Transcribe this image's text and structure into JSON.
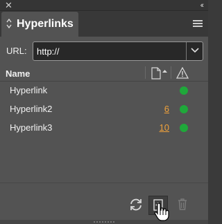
{
  "titlebar": {
    "close_icon": "close-icon",
    "collapse_icon": "collapse-icon"
  },
  "tab": {
    "label": "Hyperlinks"
  },
  "url": {
    "label": "URL:",
    "value": "http://"
  },
  "table": {
    "header_name": "Name",
    "rows": [
      {
        "name": "Hyperlink",
        "page": "",
        "status": "ok"
      },
      {
        "name": "Hyperlink2",
        "page": "6",
        "status": "ok"
      },
      {
        "name": "Hyperlink3",
        "page": "10",
        "status": "ok"
      }
    ]
  },
  "colors": {
    "status_ok": "#1fa83a",
    "page_link": "#f0a23b",
    "panel_bg": "#535353"
  }
}
